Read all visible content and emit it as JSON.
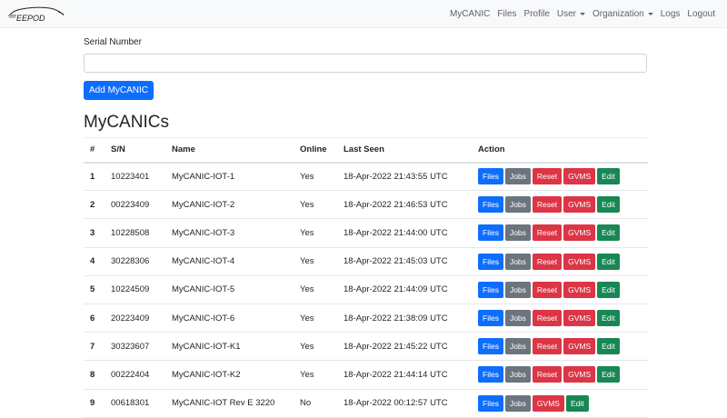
{
  "navbar": {
    "brand": "EEPOD",
    "links": [
      {
        "label": "MyCANIC",
        "name": "nav-mycanic",
        "dropdown": false
      },
      {
        "label": "Files",
        "name": "nav-files",
        "dropdown": false
      },
      {
        "label": "Profile",
        "name": "nav-profile",
        "dropdown": false
      },
      {
        "label": "User",
        "name": "nav-user",
        "dropdown": true
      },
      {
        "label": "Organization",
        "name": "nav-organization",
        "dropdown": true
      },
      {
        "label": "Logs",
        "name": "nav-logs",
        "dropdown": false
      },
      {
        "label": "Logout",
        "name": "nav-logout",
        "dropdown": false
      }
    ]
  },
  "form": {
    "serial_label": "Serial Number",
    "serial_value": "",
    "serial_placeholder": "",
    "add_button": "Add MyCANIC"
  },
  "section_title": "MyCANICs",
  "table": {
    "headers": [
      "#",
      "S/N",
      "Name",
      "Online",
      "Last Seen",
      "Action"
    ],
    "rows": [
      {
        "idx": "1",
        "sn": "10223401",
        "name": "MyCANIC-IOT-1",
        "online": "Yes",
        "last_seen": "18-Apr-2022 21:43:55 UTC",
        "actions": [
          "Files",
          "Jobs",
          "Reset",
          "GVMS",
          "Edit"
        ]
      },
      {
        "idx": "2",
        "sn": "00223409",
        "name": "MyCANIC-IOT-2",
        "online": "Yes",
        "last_seen": "18-Apr-2022 21:46:53 UTC",
        "actions": [
          "Files",
          "Jobs",
          "Reset",
          "GVMS",
          "Edit"
        ]
      },
      {
        "idx": "3",
        "sn": "10228508",
        "name": "MyCANIC-IOT-3",
        "online": "Yes",
        "last_seen": "18-Apr-2022 21:44:00 UTC",
        "actions": [
          "Files",
          "Jobs",
          "Reset",
          "GVMS",
          "Edit"
        ]
      },
      {
        "idx": "4",
        "sn": "30228306",
        "name": "MyCANIC-IOT-4",
        "online": "Yes",
        "last_seen": "18-Apr-2022 21:45:03 UTC",
        "actions": [
          "Files",
          "Jobs",
          "Reset",
          "GVMS",
          "Edit"
        ]
      },
      {
        "idx": "5",
        "sn": "10224509",
        "name": "MyCANIC-IOT-5",
        "online": "Yes",
        "last_seen": "18-Apr-2022 21:44:09 UTC",
        "actions": [
          "Files",
          "Jobs",
          "Reset",
          "GVMS",
          "Edit"
        ]
      },
      {
        "idx": "6",
        "sn": "20223409",
        "name": "MyCANIC-IOT-6",
        "online": "Yes",
        "last_seen": "18-Apr-2022 21:38:09 UTC",
        "actions": [
          "Files",
          "Jobs",
          "Reset",
          "GVMS",
          "Edit"
        ]
      },
      {
        "idx": "7",
        "sn": "30323607",
        "name": "MyCANIC-IOT-K1",
        "online": "Yes",
        "last_seen": "18-Apr-2022 21:45:22 UTC",
        "actions": [
          "Files",
          "Jobs",
          "Reset",
          "GVMS",
          "Edit"
        ]
      },
      {
        "idx": "8",
        "sn": "00222404",
        "name": "MyCANIC-IOT-K2",
        "online": "Yes",
        "last_seen": "18-Apr-2022 21:44:14 UTC",
        "actions": [
          "Files",
          "Jobs",
          "Reset",
          "GVMS",
          "Edit"
        ]
      },
      {
        "idx": "9",
        "sn": "00618301",
        "name": "MyCANIC-IOT Rev E 3220",
        "online": "No",
        "last_seen": "18-Apr-2022 00:12:57 UTC",
        "actions": [
          "Files",
          "Jobs",
          "GVMS",
          "Edit"
        ]
      }
    ]
  },
  "colors": {
    "primary": "#0d6efd",
    "secondary": "#6c757d",
    "danger": "#dc3545",
    "success": "#198754",
    "navbar_bg": "#f8f9fa"
  }
}
